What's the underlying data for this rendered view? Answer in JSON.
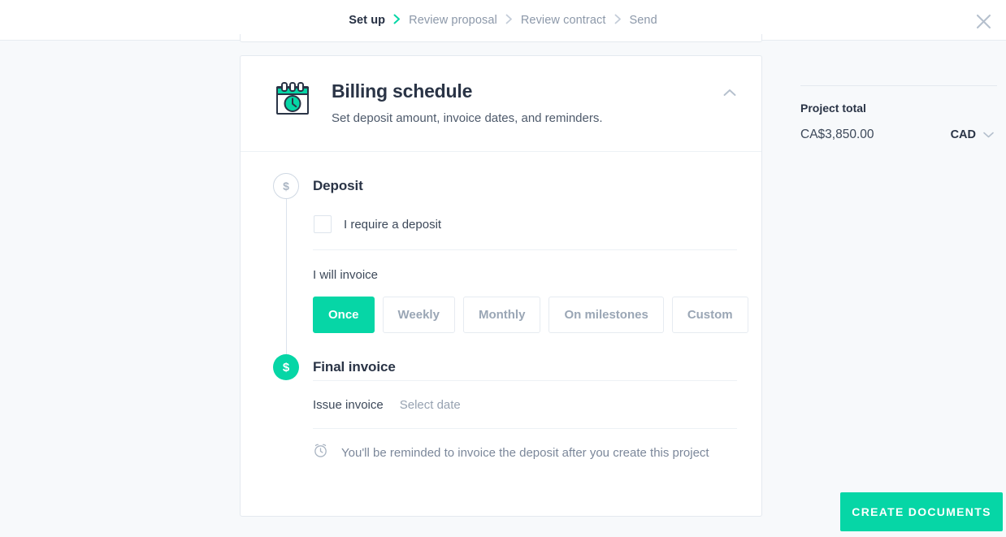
{
  "topbar": {
    "steps": [
      {
        "label": "Set up",
        "active": true
      },
      {
        "label": "Review proposal",
        "active": false
      },
      {
        "label": "Review contract",
        "active": false
      },
      {
        "label": "Send",
        "active": false
      }
    ],
    "close_icon": "close-icon"
  },
  "card": {
    "icon": "calendar-clock-icon",
    "title": "Billing schedule",
    "subtitle": "Set deposit amount, invoice dates, and reminders.",
    "collapse_icon": "chevron-up-icon"
  },
  "deposit": {
    "bullet": "$",
    "name": "Deposit",
    "checkbox_label": "I require a deposit",
    "checkbox_checked": false,
    "frequency_label": "I will invoice",
    "frequency_options": [
      {
        "label": "Once",
        "selected": true
      },
      {
        "label": "Weekly",
        "selected": false
      },
      {
        "label": "Monthly",
        "selected": false
      },
      {
        "label": "On milestones",
        "selected": false
      },
      {
        "label": "Custom",
        "selected": false
      }
    ]
  },
  "final_invoice": {
    "bullet": "$",
    "name": "Final invoice",
    "issue_label": "Issue invoice",
    "issue_value": "Select date",
    "reminder_icon": "alarm-clock-icon",
    "reminder_text": "You'll be reminded to invoice the deposit after you create this project"
  },
  "rail": {
    "title": "Project total",
    "amount": "CA$3,850.00",
    "currency": "CAD",
    "currency_icon": "chevron-down-icon"
  },
  "cta": {
    "label": "CREATE DOCUMENTS"
  },
  "colors": {
    "accent": "#06d6a6",
    "text_dark": "#2a3446",
    "text_muted": "#8c98a9",
    "page_bg": "#f7f9fb",
    "border": "#e4e9ef"
  }
}
